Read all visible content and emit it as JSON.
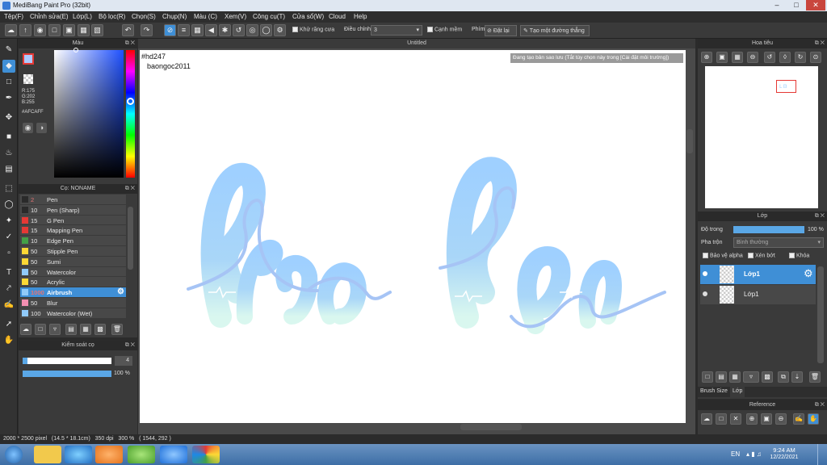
{
  "window": {
    "title": "MediBang Paint Pro (32bit)"
  },
  "menu": [
    "Tệp(F)",
    "Chỉnh sửa(E)",
    "Lớp(L)",
    "Bộ lọc(R)",
    "Chọn(S)",
    "Chụp(N)",
    "Màu (C)",
    "Xem(V)",
    "Công cụ(T)",
    "Cửa sổ(W)",
    "Cloud",
    "Help"
  ],
  "toolbar": {
    "antialias_label": "Khử răng cưa",
    "adjust_label": "Điều chỉnh",
    "adjust_value": "3",
    "smooth_label": "Cạnh mềm",
    "key_label": "Phím",
    "reset_label": "Đặt lại",
    "line_label": "Tạo một đường thẳng"
  },
  "color_panel": {
    "title": "Màu",
    "r": "R:175",
    "g": "G:202",
    "b": "B:255",
    "hex": "#AFCAFF",
    "current_color": "#afcaff"
  },
  "brush_panel": {
    "title": "Cọ: NONAME",
    "brushes": [
      {
        "size": "2",
        "name": "Pen",
        "color": "#2a2a2a"
      },
      {
        "size": "10",
        "name": "Pen (Sharp)",
        "color": "#2a2a2a"
      },
      {
        "size": "15",
        "name": "G Pen",
        "color": "#e53935"
      },
      {
        "size": "15",
        "name": "Mapping Pen",
        "color": "#e53935"
      },
      {
        "size": "10",
        "name": "Edge Pen",
        "color": "#43a047"
      },
      {
        "size": "50",
        "name": "Stipple Pen",
        "color": "#fdd835"
      },
      {
        "size": "50",
        "name": "Sumi",
        "color": "#fdd835"
      },
      {
        "size": "50",
        "name": "Watercolor",
        "color": "#90caf9"
      },
      {
        "size": "50",
        "name": "Acrylic",
        "color": "#fdd835"
      },
      {
        "size": "1000",
        "name": "Airbrush",
        "color": "#90caf9",
        "selected": true
      },
      {
        "size": "50",
        "name": "Blur",
        "color": "#f48fb1"
      },
      {
        "size": "100",
        "name": "Watercolor (Wet)",
        "color": "#90caf9"
      }
    ]
  },
  "brush_control": {
    "title": "Kiểm soát cọ",
    "size_value": "4",
    "size_fraction": 0.05,
    "opacity_value": "100 %",
    "opacity_fraction": 1.0
  },
  "document": {
    "tab_title": "Untitled",
    "notification": "Đang tạo bản sao lưu (Tắt tùy chọn này trong [Cài đặt môi trường])",
    "text_line1": "#hd247",
    "text_line2": "baongoc2011"
  },
  "navigator": {
    "title": "Hoa tiêu"
  },
  "layer_panel": {
    "title": "Lớp",
    "opacity_label": "Độ trong",
    "opacity_value": "100 %",
    "opacity_fraction": 1.0,
    "blend_label": "Pha trộn",
    "blend_value": "Bình thường",
    "protect_alpha": "Bảo vệ alpha",
    "clipping": "Xén bớt",
    "lock": "Khóa",
    "layers": [
      {
        "name": "Lớp1",
        "selected": true
      },
      {
        "name": "Lớp1",
        "selected": false
      }
    ],
    "tab_brush_size": "Brush Size",
    "tab_layer": "Lớp"
  },
  "reference": {
    "title": "Reference"
  },
  "status": {
    "text": "2000 * 2500 pixel   (14.5 * 18.1cm)   350 dpi   300 %   ( 1544, 292 )"
  },
  "taskbar": {
    "lang": "EN",
    "time": "9:24 AM",
    "date": "12/22/2021"
  }
}
